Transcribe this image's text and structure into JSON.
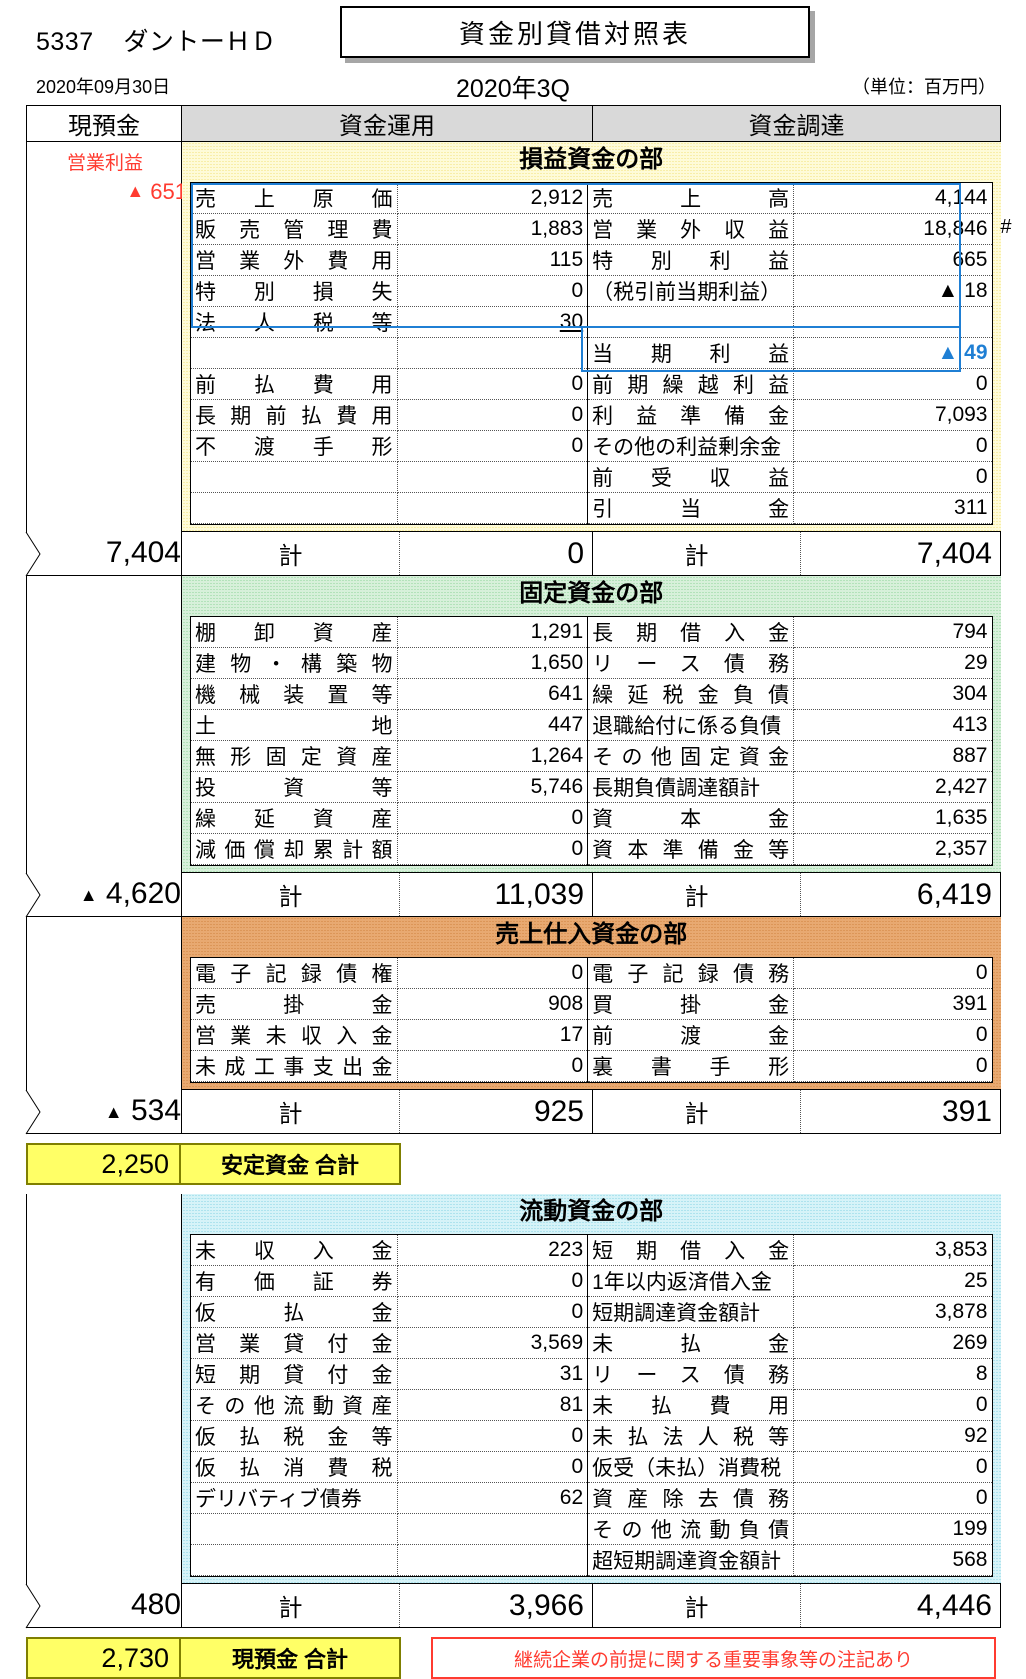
{
  "header": {
    "company_code": "5337",
    "company_name": "ダントーＨＤ",
    "title": "資金別貸借対照表",
    "date": "2020年09月30日",
    "period": "2020年3Q",
    "unit": "（単位：百万円）"
  },
  "columns": {
    "cash": "現預金",
    "use": "資金運用",
    "source": "資金調達"
  },
  "labels": {
    "total": "計",
    "operating_profit_label": "営業利益",
    "operating_profit_value": "▲ 651",
    "hash_mark": "#"
  },
  "sections": [
    {
      "id": "pl",
      "banner": "損益資金の部",
      "color": "#fefbd8",
      "cash_value": "7,404",
      "left": [
        {
          "name": "売上原価",
          "value": "2,912"
        },
        {
          "name": "販売管理費",
          "value": "1,883"
        },
        {
          "name": "営業外費用",
          "value": "115"
        },
        {
          "name": "特別損失",
          "value": "0"
        },
        {
          "name": "法人税等",
          "value": "30"
        },
        {
          "name": "",
          "value": ""
        },
        {
          "name": "前払費用",
          "value": "0"
        },
        {
          "name": "長期前払費用",
          "value": "0"
        },
        {
          "name": "不渡手形",
          "value": "0"
        },
        {
          "name": "",
          "value": ""
        },
        {
          "name": "",
          "value": ""
        }
      ],
      "right": [
        {
          "name": "売上高",
          "value": "4,144"
        },
        {
          "name": "営業外収益",
          "value": "18,846"
        },
        {
          "name": "特別利益",
          "value": "665"
        },
        {
          "name": "（税引前当期利益）",
          "value": "▲ 18"
        },
        {
          "name": "",
          "value": ""
        },
        {
          "name": "当期利益",
          "value": "▲ 49"
        },
        {
          "name": "前期繰越利益",
          "value": "0"
        },
        {
          "name": "利益準備金",
          "value": "7,093"
        },
        {
          "name": "その他の利益剰余金",
          "value": "0"
        },
        {
          "name": "前受収益",
          "value": "0"
        },
        {
          "name": "引当金",
          "value": "311"
        }
      ],
      "total_left": "0",
      "total_right": "7,404"
    },
    {
      "id": "fixed",
      "banner": "固定資金の部",
      "color": "#d7f0da",
      "cash_value": "▲ 4,620",
      "left": [
        {
          "name": "棚卸資産",
          "value": "1,291"
        },
        {
          "name": "建物・構築物",
          "value": "1,650"
        },
        {
          "name": "機械装置等",
          "value": "641"
        },
        {
          "name": "土地",
          "value": "447"
        },
        {
          "name": "無形固定資産",
          "value": "1,264"
        },
        {
          "name": "投資等",
          "value": "5,746"
        },
        {
          "name": "繰延資産",
          "value": "0"
        },
        {
          "name": "減価償却累計額",
          "value": "0"
        }
      ],
      "right": [
        {
          "name": "長期借入金",
          "value": "794"
        },
        {
          "name": "リース債務",
          "value": "29"
        },
        {
          "name": "繰延税金負債",
          "value": "304"
        },
        {
          "name": "退職給付に係る負債",
          "value": "413"
        },
        {
          "name": "その他固定資金",
          "value": "887"
        },
        {
          "name": "長期負債調達額計",
          "value": "2,427"
        },
        {
          "name": "資本金",
          "value": "1,635"
        },
        {
          "name": "資本準備金等",
          "value": "2,357"
        }
      ],
      "total_left": "11,039",
      "total_right": "6,419"
    },
    {
      "id": "trade",
      "banner": "売上仕入資金の部",
      "color": "#e8a971",
      "cash_value": "▲ 534",
      "left": [
        {
          "name": "電子記録債権",
          "value": "0"
        },
        {
          "name": "売掛金",
          "value": "908"
        },
        {
          "name": "営業未収入金",
          "value": "17"
        },
        {
          "name": "未成工事支出金",
          "value": "0"
        }
      ],
      "right": [
        {
          "name": "電子記録債務",
          "value": "0"
        },
        {
          "name": "買掛金",
          "value": "391"
        },
        {
          "name": "前渡金",
          "value": "0"
        },
        {
          "name": "裏書手形",
          "value": "0"
        }
      ],
      "total_left": "925",
      "total_right": "391"
    },
    {
      "id": "liquid",
      "banner": "流動資金の部",
      "color": "#d6f3f8",
      "cash_value": "480",
      "left": [
        {
          "name": "未収入金",
          "value": "223"
        },
        {
          "name": "有価証券",
          "value": "0"
        },
        {
          "name": "仮払金",
          "value": "0"
        },
        {
          "name": "営業貸付金",
          "value": "3,569"
        },
        {
          "name": "短期貸付金",
          "value": "31"
        },
        {
          "name": "その他流動資産",
          "value": "81"
        },
        {
          "name": "仮払税金等",
          "value": "0"
        },
        {
          "name": "仮払消費税",
          "value": "0"
        },
        {
          "name": "デリバティブ債券",
          "value": "62"
        },
        {
          "name": "",
          "value": ""
        },
        {
          "name": "",
          "value": ""
        }
      ],
      "right": [
        {
          "name": "短期借入金",
          "value": "3,853"
        },
        {
          "name": "1年以内返済借入金",
          "value": "25"
        },
        {
          "name": "短期調達資金額計",
          "value": "3,878"
        },
        {
          "name": "未払金",
          "value": "269"
        },
        {
          "name": "リース債務",
          "value": "8"
        },
        {
          "name": "未払費用",
          "value": "0"
        },
        {
          "name": "未払法人税等",
          "value": "92"
        },
        {
          "name": "仮受（未払）消費税",
          "value": "0"
        },
        {
          "name": "資産除去債務",
          "value": "0"
        },
        {
          "name": "その他流動負債",
          "value": "199"
        },
        {
          "name": "超短期調達資金額計",
          "value": "568"
        }
      ],
      "total_left": "3,966",
      "total_right": "4,446"
    }
  ],
  "summaries": {
    "stable": {
      "value": "2,250",
      "label": "安定資金 合計"
    },
    "cash": {
      "value": "2,730",
      "label": "現預金 合計"
    }
  },
  "footer_note": "継続企業の前提に関する重要事象等の注記あり"
}
